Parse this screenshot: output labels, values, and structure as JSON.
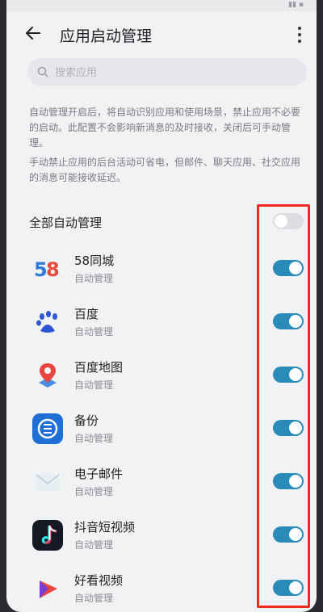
{
  "header": {
    "title": "应用启动管理"
  },
  "search": {
    "placeholder": "搜索应用"
  },
  "description": {
    "p1": "自动管理开启后，将自动识别应用和使用场景，禁止应用不必要的启动。此配置不会影响新消息的及时接收，关闭后可手动管理。",
    "p2": "手动禁止应用的后台活动可省电，但邮件、聊天应用、社交应用的消息可能接收延迟。"
  },
  "all_auto": {
    "label": "全部自动管理",
    "enabled": false
  },
  "apps": [
    {
      "name": "58同城",
      "status": "自动管理",
      "icon": "58-logo-icon",
      "enabled": true
    },
    {
      "name": "百度",
      "status": "自动管理",
      "icon": "baidu-paw-icon",
      "enabled": true
    },
    {
      "name": "百度地图",
      "status": "自动管理",
      "icon": "baidu-map-icon",
      "enabled": true
    },
    {
      "name": "备份",
      "status": "自动管理",
      "icon": "backup-icon",
      "enabled": true
    },
    {
      "name": "电子邮件",
      "status": "自动管理",
      "icon": "email-icon",
      "enabled": true
    },
    {
      "name": "抖音短视频",
      "status": "自动管理",
      "icon": "douyin-icon",
      "enabled": true
    },
    {
      "name": "好看视频",
      "status": "自动管理",
      "icon": "haokan-video-icon",
      "enabled": true
    }
  ],
  "colors": {
    "toggle_on": "#2a8bb8",
    "highlight": "#ee2a1f"
  }
}
